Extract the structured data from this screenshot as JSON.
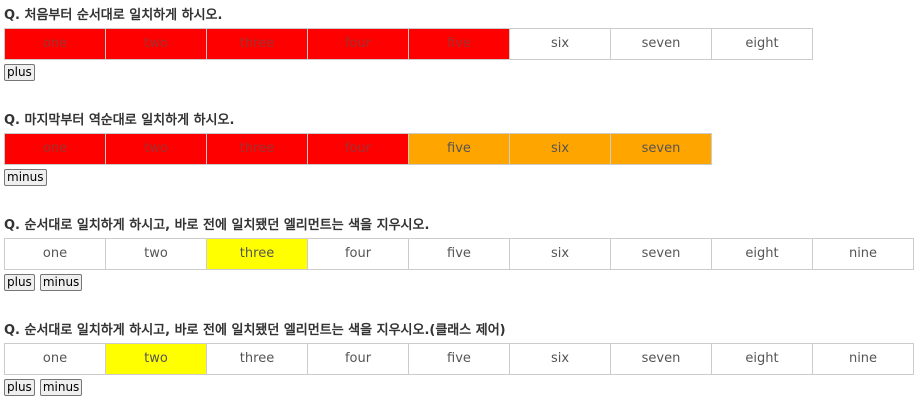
{
  "colors": {
    "red": "#ff0000",
    "orange": "#ffa500",
    "yellow": "#ffff00",
    "white": "#ffffff",
    "faded_text": "#a03030"
  },
  "sections": [
    {
      "question": "Q. 처음부터 순서대로 일치하게 하시오.",
      "cells": [
        {
          "label": "one",
          "fill": "red"
        },
        {
          "label": "two",
          "fill": "red"
        },
        {
          "label": "three",
          "fill": "red"
        },
        {
          "label": "four",
          "fill": "red"
        },
        {
          "label": "five",
          "fill": "red"
        },
        {
          "label": "six",
          "fill": "white"
        },
        {
          "label": "seven",
          "fill": "white"
        },
        {
          "label": "eight",
          "fill": "white"
        }
      ],
      "buttons": [
        "plus"
      ]
    },
    {
      "question": "Q. 마지막부터 역순대로 일치하게 하시오.",
      "cells": [
        {
          "label": "one",
          "fill": "red"
        },
        {
          "label": "two",
          "fill": "red"
        },
        {
          "label": "three",
          "fill": "red"
        },
        {
          "label": "four",
          "fill": "red"
        },
        {
          "label": "five",
          "fill": "orange"
        },
        {
          "label": "six",
          "fill": "orange"
        },
        {
          "label": "seven",
          "fill": "orange"
        }
      ],
      "buttons": [
        "minus"
      ]
    },
    {
      "question": "Q. 순서대로 일치하게 하시고, 바로 전에 일치됐던 엘리먼트는 색을 지우시오.",
      "cells": [
        {
          "label": "one",
          "fill": "white"
        },
        {
          "label": "two",
          "fill": "white"
        },
        {
          "label": "three",
          "fill": "yellow"
        },
        {
          "label": "four",
          "fill": "white"
        },
        {
          "label": "five",
          "fill": "white"
        },
        {
          "label": "six",
          "fill": "white"
        },
        {
          "label": "seven",
          "fill": "white"
        },
        {
          "label": "eight",
          "fill": "white"
        },
        {
          "label": "nine",
          "fill": "white"
        }
      ],
      "buttons": [
        "plus",
        "minus"
      ]
    },
    {
      "question": "Q. 순서대로 일치하게 하시고, 바로 전에 일치됐던 엘리먼트는 색을 지우시오.(클래스 제어)",
      "cells": [
        {
          "label": "one",
          "fill": "white"
        },
        {
          "label": "two",
          "fill": "yellow"
        },
        {
          "label": "three",
          "fill": "white"
        },
        {
          "label": "four",
          "fill": "white"
        },
        {
          "label": "five",
          "fill": "white"
        },
        {
          "label": "six",
          "fill": "white"
        },
        {
          "label": "seven",
          "fill": "white"
        },
        {
          "label": "eight",
          "fill": "white"
        },
        {
          "label": "nine",
          "fill": "white"
        }
      ],
      "buttons": [
        "plus",
        "minus"
      ]
    }
  ]
}
